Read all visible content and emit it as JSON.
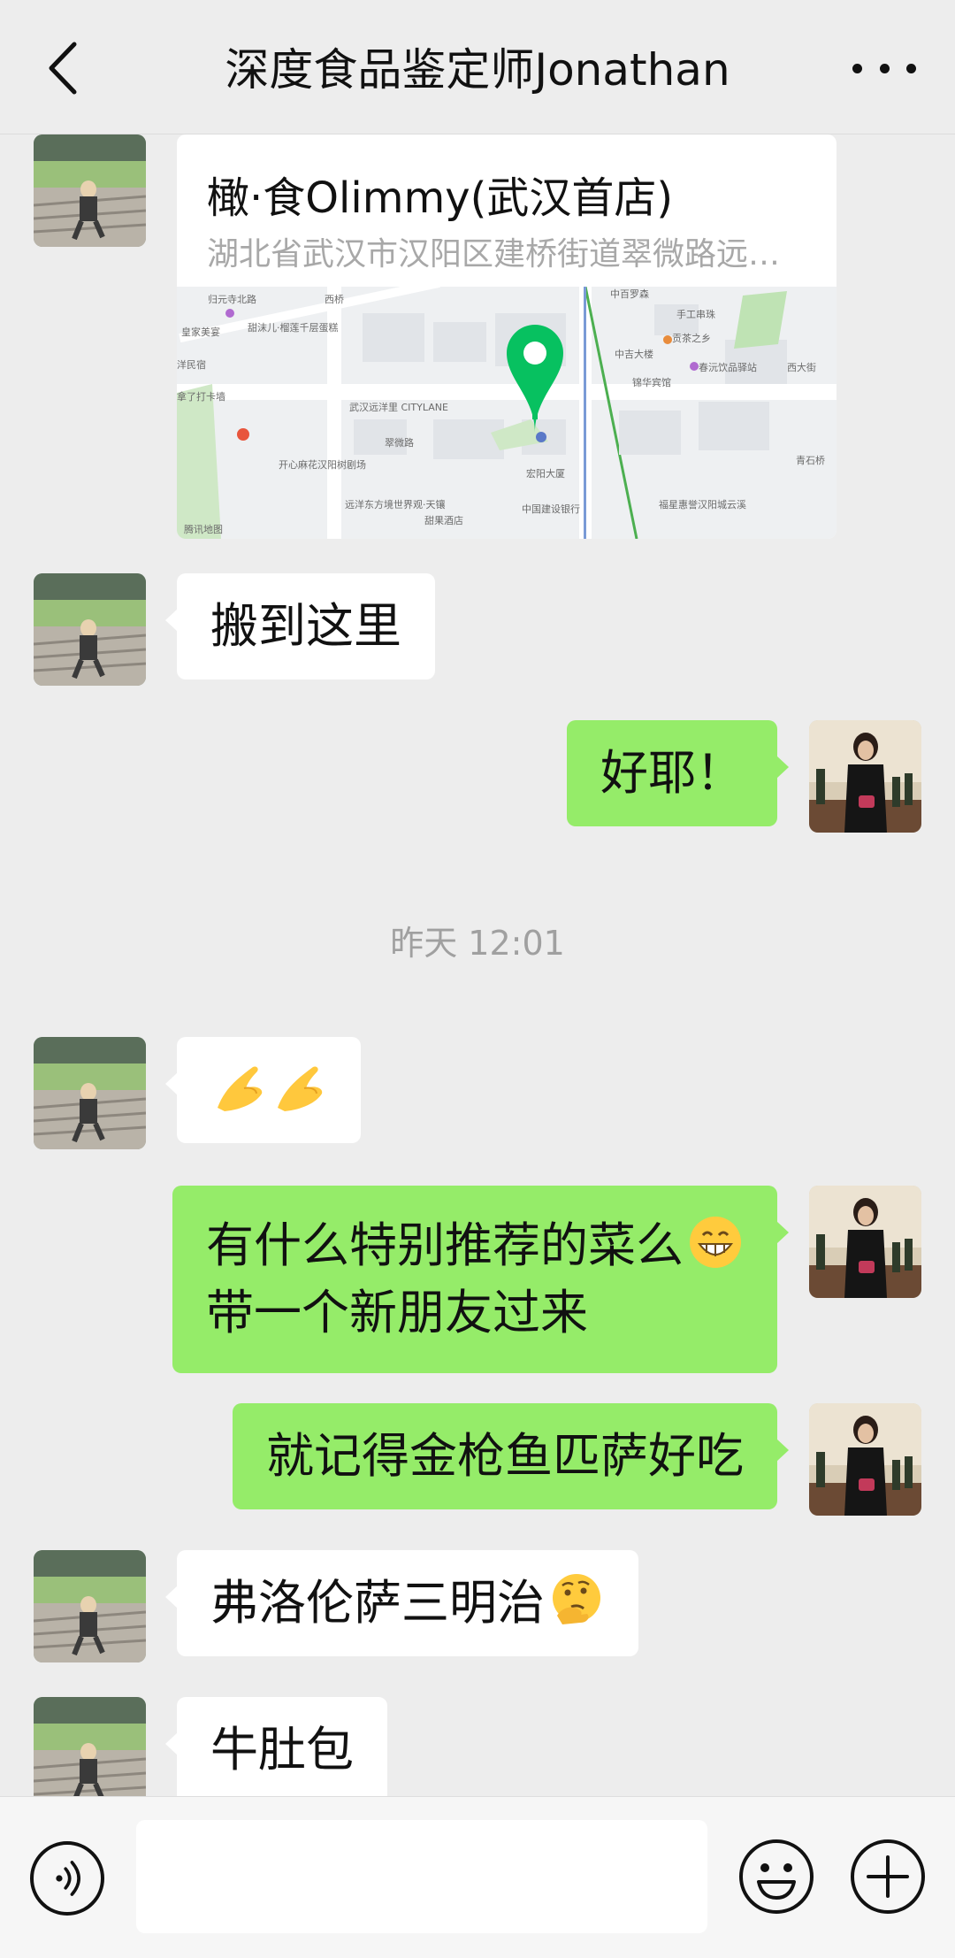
{
  "header": {
    "title": "深度食品鉴定师Jonathan"
  },
  "messages": {
    "location": {
      "name": "橄·食Olimmy(武汉首店)",
      "address": "湖北省武汉市汉阳区建桥街道翠微路远洋…",
      "map": {
        "labels": {
          "l1": "归元寺北路",
          "l2": "皇家美宴",
          "l3": "甜沫儿·榴莲千层蛋糕",
          "l4": "洋民宿",
          "l5": "拿了打卡墙",
          "l6": "武汉远洋里 CITYLANE",
          "l7": "翠微路",
          "l8": "开心麻花汉阳树剧场",
          "l9": "远洋东方境世界观·天镶",
          "l10": "甜果酒店",
          "l11": "宏阳大厦",
          "l12": "中国建设银行",
          "l13": "福星惠誉汉阳城云溪",
          "l14": "中百罗森",
          "l15": "手工串珠",
          "l16": "贡茶之乡",
          "l17": "中吉大楼",
          "l18": "春沅饮品驿站",
          "l19": "锦华宾馆",
          "l20": "西桥",
          "l21": "腾讯地图",
          "l22": "西大街",
          "l23": "青石桥"
        }
      }
    },
    "m2": "搬到这里",
    "m3": "好耶！",
    "timestamp": "昨天 12:01",
    "m4_emoji": "pinched-hands-emoji x2",
    "m5_line1": "有什么特别推荐的菜么",
    "m5_line2": "带一个新朋友过来",
    "m6": "就记得金枪鱼匹萨好吃",
    "m7": "弗洛伦萨三明治",
    "m8": "牛肚包"
  },
  "input_bar": {
    "voice_icon": "voice-icon",
    "emoji_icon": "smiley-icon",
    "plus_icon": "plus-icon"
  },
  "colors": {
    "background": "#ededed",
    "bubble_self": "#95ec69",
    "bubble_other": "#ffffff",
    "map_pin": "#07c160"
  }
}
